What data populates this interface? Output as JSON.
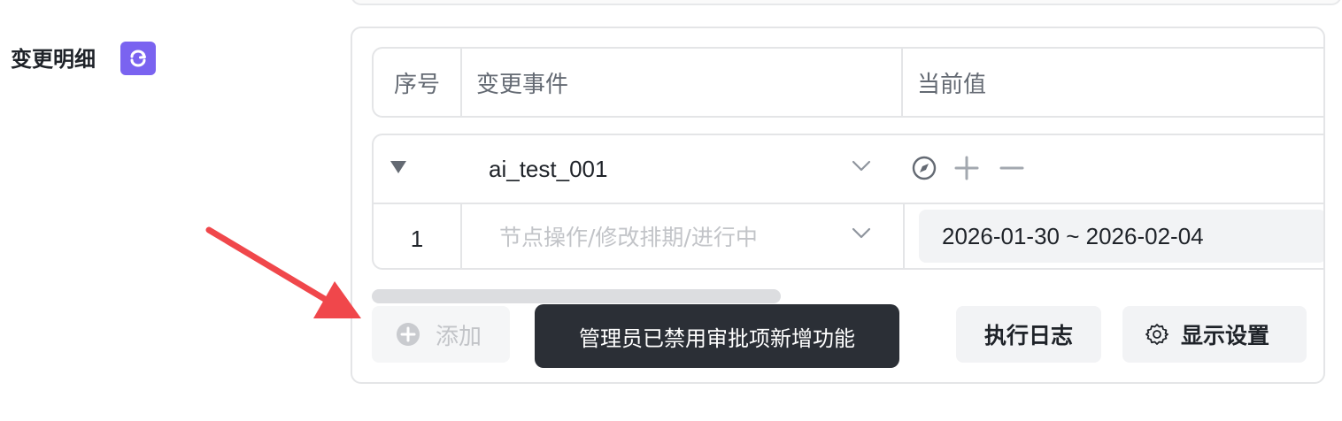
{
  "section": {
    "title": "变更明细",
    "icon": "sync-arrows-icon",
    "icon_color": "#7a63f0"
  },
  "table": {
    "columns": [
      "序号",
      "变更事件",
      "当前值"
    ],
    "group": {
      "name": "ai_test_001",
      "actions": [
        "compass-icon",
        "plus-icon",
        "minus-icon"
      ],
      "rows": [
        {
          "index": "1",
          "event_placeholder": "节点操作/修改排期/进行中",
          "current_value": "2026-01-30 ~ 2026-02-04"
        }
      ]
    }
  },
  "footer": {
    "add_label": "添加",
    "add_disabled": true,
    "tooltip": "管理员已禁用审批项新增功能",
    "log_label": "执行日志",
    "display_settings_label": "显示设置"
  },
  "annotation": {
    "arrow_color": "#f0474b",
    "arrow_target": "add-button"
  }
}
